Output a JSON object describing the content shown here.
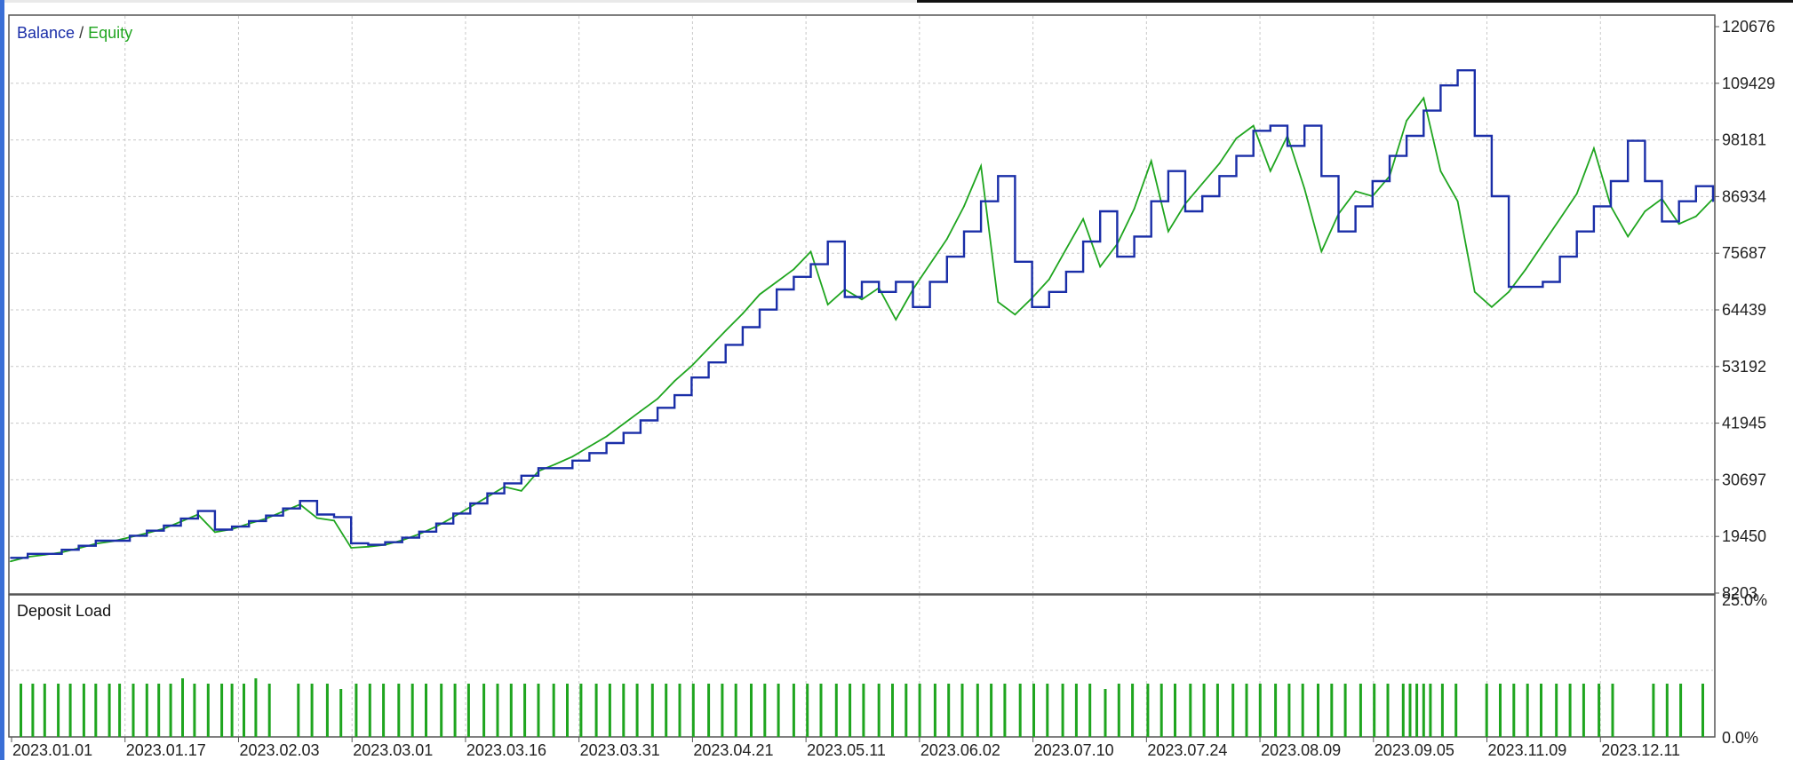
{
  "main_panel": {
    "legend": {
      "balance_label": "Balance",
      "separator": " / ",
      "equity_label": "Equity"
    }
  },
  "deposit_panel": {
    "title": "Deposit Load"
  },
  "colors": {
    "balance": "#1a2ea8",
    "equity": "#1fa51f",
    "grid": "#c8c8c8",
    "panel_border": "#555555",
    "deposit_bar": "#1fa51f"
  },
  "chart_data": [
    {
      "type": "line",
      "panel": "balance-equity",
      "title": "",
      "xlabel": "",
      "ylabel": "",
      "ylim": [
        8203,
        120676
      ],
      "y_ticks": [
        "120676",
        "109429",
        "98181",
        "86934",
        "75687",
        "64439",
        "53192",
        "41945",
        "30697",
        "19450",
        "8203"
      ],
      "x_tick_labels": [
        "2023.01.01",
        "2023.01.17",
        "2023.02.03",
        "2023.03.01",
        "2023.03.16",
        "2023.03.31",
        "2023.04.21",
        "2023.05.11",
        "2023.06.02",
        "2023.07.10",
        "2023.07.24",
        "2023.08.09",
        "2023.09.05",
        "2023.11.09",
        "2023.12.11"
      ],
      "grid": true,
      "legend": "top-left",
      "x_domain": [
        0,
        100
      ],
      "series": [
        {
          "name": "Balance",
          "color": "#1a2ea8",
          "x": [
            0,
            1,
            3,
            4,
            5,
            7,
            8,
            9,
            10,
            11,
            12,
            13,
            14,
            15,
            16,
            17,
            18,
            19,
            20,
            21,
            22,
            23,
            24,
            25,
            26,
            27,
            28,
            29,
            30,
            31,
            33,
            34,
            35,
            36,
            37,
            38,
            39,
            40,
            41,
            42,
            43,
            44,
            45,
            46,
            47,
            48,
            49,
            50,
            51,
            52,
            53,
            54,
            55,
            56,
            57,
            58,
            59,
            60,
            61,
            62,
            63,
            64,
            65,
            66,
            67,
            68,
            69,
            70,
            71,
            72,
            73,
            74,
            75,
            76,
            77,
            78,
            79,
            80,
            81,
            82,
            83,
            84,
            85,
            86,
            87,
            88,
            89,
            90,
            91,
            92,
            93,
            94,
            95,
            96,
            97,
            98,
            99,
            100
          ],
          "values": [
            15200,
            16000,
            16800,
            17600,
            18600,
            19600,
            20600,
            21600,
            23000,
            24500,
            20800,
            21400,
            22500,
            23600,
            25000,
            26500,
            23800,
            23300,
            18100,
            17800,
            18300,
            19200,
            20400,
            22000,
            24000,
            26000,
            28000,
            30000,
            31500,
            33000,
            34500,
            36000,
            38000,
            40000,
            42500,
            45000,
            47500,
            51000,
            54000,
            57500,
            61000,
            64500,
            68500,
            71000,
            73500,
            78000,
            67000,
            70000,
            68000,
            70000,
            65000,
            70000,
            75000,
            80000,
            86000,
            91000,
            74000,
            65000,
            68000,
            72000,
            78000,
            84000,
            75000,
            79000,
            86000,
            92000,
            84000,
            87000,
            91000,
            95000,
            100000,
            101000,
            97000,
            101000,
            91000,
            80000,
            85000,
            90000,
            95000,
            99000,
            104000,
            109000,
            112000,
            99000,
            87000,
            69000,
            69000,
            70000,
            75000,
            80000,
            85000,
            90000,
            98000,
            90000,
            82000,
            86000,
            89000,
            86000
          ]
        },
        {
          "name": "Equity",
          "color": "#1fa51f",
          "x": [
            0,
            1,
            2,
            3,
            4,
            5,
            6,
            7,
            8,
            9,
            10,
            11,
            12,
            13,
            14,
            15,
            16,
            17,
            18,
            19,
            20,
            21,
            22,
            23,
            24,
            25,
            26,
            27,
            28,
            29,
            30,
            31,
            32,
            33,
            34,
            35,
            36,
            37,
            38,
            39,
            40,
            41,
            42,
            43,
            44,
            45,
            46,
            47,
            48,
            49,
            50,
            51,
            52,
            53,
            54,
            55,
            56,
            57,
            58,
            59,
            60,
            61,
            62,
            63,
            64,
            65,
            66,
            67,
            68,
            69,
            70,
            71,
            72,
            73,
            74,
            75,
            76,
            77,
            78,
            79,
            80,
            81,
            82,
            83,
            84,
            85,
            86,
            87,
            88,
            89,
            90,
            91,
            92,
            93,
            94,
            95,
            96,
            97,
            98,
            99,
            100
          ],
          "values": [
            14500,
            15400,
            15800,
            16300,
            17100,
            18000,
            18500,
            19300,
            20100,
            21000,
            22400,
            23800,
            20300,
            20900,
            22000,
            23000,
            24400,
            25800,
            23100,
            22600,
            17200,
            17400,
            17800,
            18700,
            19900,
            21400,
            23300,
            25300,
            27300,
            29300,
            28500,
            32400,
            33800,
            35300,
            37300,
            39300,
            41800,
            44300,
            46800,
            50300,
            53300,
            56800,
            60300,
            63700,
            67500,
            70000,
            72500,
            76000,
            65500,
            68500,
            66500,
            68800,
            62500,
            68500,
            73500,
            78500,
            85000,
            93000,
            66000,
            63500,
            66800,
            70500,
            76500,
            82500,
            73000,
            77500,
            84500,
            94000,
            80000,
            85500,
            89500,
            93500,
            98500,
            101000,
            92000,
            99000,
            88500,
            76000,
            83500,
            88000,
            87000,
            91000,
            102000,
            106500,
            92000,
            86000,
            68000,
            65000,
            68000,
            72500,
            77500,
            82500,
            87500,
            96500,
            85000,
            79000,
            84000,
            86500,
            81500,
            83000,
            86500
          ]
        }
      ]
    },
    {
      "type": "bar",
      "panel": "deposit-load",
      "title": "Deposit Load",
      "xlabel": "",
      "ylabel": "",
      "ylim": [
        0,
        25
      ],
      "y_ticks": [
        "25.0%",
        "0.0%"
      ],
      "unit": "%",
      "x_domain": [
        0,
        100
      ],
      "x": [
        0.6,
        1.3,
        2.0,
        2.8,
        3.5,
        4.3,
        5.0,
        5.8,
        6.4,
        7.2,
        8.0,
        8.7,
        9.4,
        10.1,
        10.8,
        11.6,
        12.4,
        13.0,
        13.7,
        14.4,
        15.2,
        16.9,
        17.7,
        18.6,
        19.4,
        20.3,
        21.1,
        21.9,
        22.8,
        23.6,
        24.4,
        25.3,
        26.1,
        26.9,
        27.8,
        28.6,
        29.4,
        30.2,
        31.0,
        31.9,
        32.7,
        33.5,
        34.4,
        35.2,
        36.0,
        36.8,
        37.7,
        38.5,
        39.3,
        40.1,
        41.0,
        41.8,
        42.6,
        43.5,
        44.3,
        45.1,
        46.0,
        46.8,
        47.6,
        48.5,
        49.3,
        50.1,
        51.0,
        51.8,
        52.6,
        53.4,
        54.3,
        55.1,
        55.9,
        56.8,
        57.6,
        58.4,
        59.3,
        60.1,
        60.9,
        61.8,
        62.6,
        63.4,
        64.3,
        65.1,
        65.9,
        66.8,
        67.6,
        68.4,
        69.3,
        70.1,
        70.9,
        71.8,
        72.6,
        73.4,
        74.3,
        75.1,
        75.9,
        76.8,
        77.6,
        78.4,
        79.3,
        80.1,
        80.9,
        81.8,
        82.2,
        82.6,
        83.0,
        83.4,
        84.1,
        84.9,
        86.7,
        87.5,
        88.3,
        89.1,
        89.9,
        90.8,
        91.6,
        92.4,
        93.3,
        94.1,
        96.5,
        97.3,
        98.1,
        99.4
      ],
      "values": [
        10,
        10,
        10,
        10,
        10,
        10,
        10,
        10,
        10,
        10,
        10,
        10,
        10,
        11,
        10,
        10,
        10,
        10,
        10,
        11,
        10,
        10,
        10,
        10,
        9,
        10,
        10,
        10,
        10,
        10,
        10,
        10,
        10,
        10,
        10,
        10,
        10,
        10,
        10,
        10,
        10,
        10,
        10,
        10,
        10,
        10,
        10,
        10,
        10,
        10,
        10,
        10,
        10,
        10,
        10,
        10,
        10,
        10,
        10,
        10,
        10,
        10,
        10,
        10,
        10,
        10,
        10,
        10,
        10,
        10,
        10,
        10,
        10,
        10,
        10,
        10,
        10,
        10,
        9,
        10,
        10,
        10,
        10,
        10,
        10,
        10,
        10,
        10,
        10,
        10,
        10,
        10,
        10,
        10,
        10,
        10,
        10,
        10,
        10,
        10,
        10,
        10,
        10,
        10,
        10,
        10,
        10,
        10,
        10,
        10,
        10,
        10,
        10,
        10,
        10,
        10,
        10,
        10,
        10,
        10
      ]
    }
  ]
}
